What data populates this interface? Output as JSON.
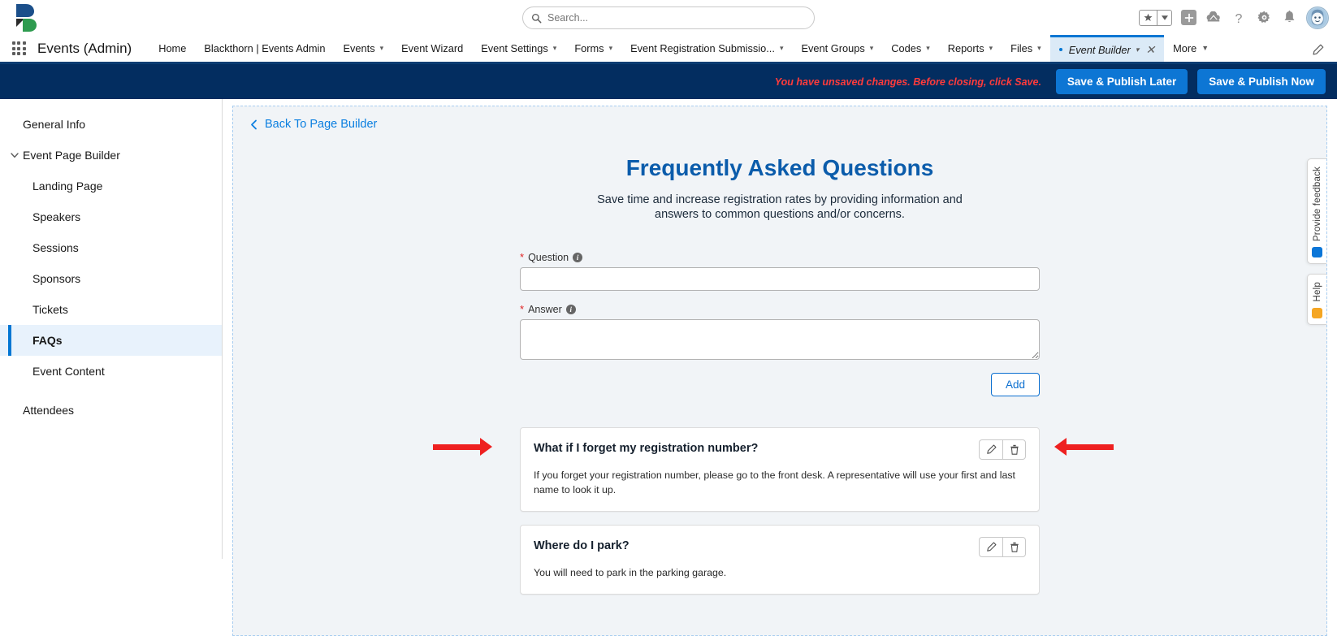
{
  "global": {
    "search_placeholder": "Search...",
    "icons": {
      "favorites": "star-icon",
      "favorites_caret": "caret-down-icon",
      "add": "plus-icon",
      "cloud": "cloud-home-icon",
      "help": "question-mark-icon",
      "setup": "gear-icon",
      "notifications": "bell-icon",
      "profile": "avatar-icon"
    },
    "logo": "blackthorn-logo"
  },
  "appnav": {
    "waffle": "app-launcher-icon",
    "app_name": "Events (Admin)",
    "items": [
      {
        "label": "Home",
        "caret": false,
        "active": false
      },
      {
        "label": "Blackthorn | Events Admin",
        "caret": false,
        "active": false
      },
      {
        "label": "Events",
        "caret": true,
        "active": false
      },
      {
        "label": "Event Wizard",
        "caret": false,
        "active": false
      },
      {
        "label": "Event Settings",
        "caret": true,
        "active": false
      },
      {
        "label": "Forms",
        "caret": true,
        "active": false
      },
      {
        "label": "Event Registration Submissio...",
        "caret": true,
        "active": false
      },
      {
        "label": "Event Groups",
        "caret": true,
        "active": false
      },
      {
        "label": "Codes",
        "caret": true,
        "active": false
      },
      {
        "label": "Reports",
        "caret": true,
        "active": false
      },
      {
        "label": "Files",
        "caret": true,
        "active": false
      },
      {
        "label": "Event Builder",
        "caret": true,
        "active": true,
        "unsaved": true,
        "closable": true
      },
      {
        "label": "More",
        "caret": true,
        "active": false,
        "solid_caret": true
      }
    ],
    "edit_icon": "pencil-icon"
  },
  "banner": {
    "message": "You have unsaved changes. Before closing, click Save.",
    "save_later_label": "Save & Publish Later",
    "save_now_label": "Save & Publish Now",
    "bg_color": "#032d60",
    "message_color": "#ff3b3b",
    "button_color": "#0d76d4"
  },
  "sidebar": {
    "items": [
      {
        "label": "General Info",
        "level": 0,
        "twisty": false,
        "selected": false
      },
      {
        "label": "Event Page Builder",
        "level": 0,
        "twisty": true,
        "selected": false
      },
      {
        "label": "Landing Page",
        "level": 1,
        "twisty": false,
        "selected": false
      },
      {
        "label": "Speakers",
        "level": 1,
        "twisty": false,
        "selected": false
      },
      {
        "label": "Sessions",
        "level": 1,
        "twisty": false,
        "selected": false
      },
      {
        "label": "Sponsors",
        "level": 1,
        "twisty": false,
        "selected": false
      },
      {
        "label": "Tickets",
        "level": 1,
        "twisty": false,
        "selected": false
      },
      {
        "label": "FAQs",
        "level": 1,
        "twisty": false,
        "selected": true
      },
      {
        "label": "Event Content",
        "level": 1,
        "twisty": false,
        "selected": false
      },
      {
        "label": "Attendees",
        "level": 0,
        "twisty": false,
        "selected": false,
        "gap_before": true
      }
    ],
    "selected_bg": "#e8f2fc",
    "selected_bar": "#0176d3"
  },
  "canvas": {
    "back_link": "Back To Page Builder",
    "back_icon": "chevron-left-icon",
    "title": "Frequently Asked Questions",
    "title_color": "#0b5cab",
    "subtitle": "Save time and increase registration rates by providing information and answers to common questions and/or concerns.",
    "form": {
      "question": {
        "label": "Question",
        "required": true,
        "info_icon": "info-icon",
        "value": "",
        "placeholder": ""
      },
      "answer": {
        "label": "Answer",
        "required": true,
        "info_icon": "info-icon",
        "value": "",
        "placeholder": ""
      },
      "add_label": "Add"
    },
    "faqs": [
      {
        "question": "What if I forget my registration number?",
        "answer": "If you forget your registration number, please go to the front desk. A representative will use your first and last name to look it up.",
        "edit_icon": "pencil-icon",
        "delete_icon": "trash-icon",
        "annotated": true
      },
      {
        "question": "Where do I park?",
        "answer": "You will need to park in the parking garage.",
        "edit_icon": "pencil-icon",
        "delete_icon": "trash-icon",
        "annotated": false
      }
    ]
  },
  "right_rail": {
    "feedback_label": "Provide feedback",
    "feedback_badge": "#0b76d8",
    "help_label": "Help",
    "help_badge": "#f5a623"
  },
  "annotation": {
    "color": "#ee2020",
    "arrow_left_target": "edit-button",
    "arrow_right_target": "delete-button"
  }
}
